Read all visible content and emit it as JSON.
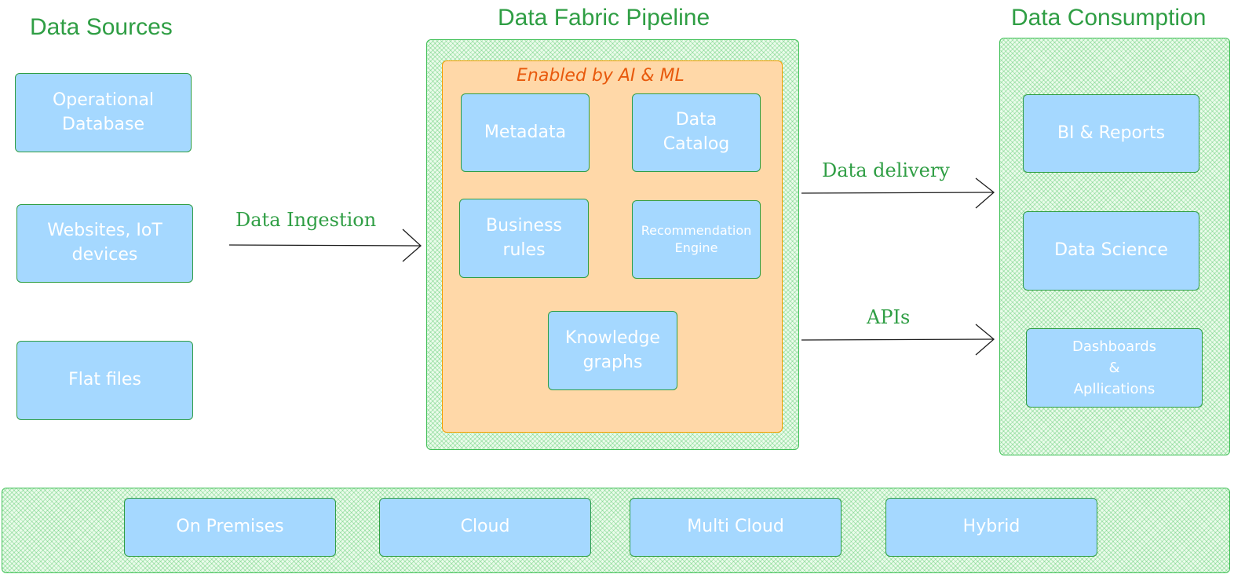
{
  "sections": {
    "sources_title": "Data Sources",
    "pipeline_title": "Data Fabric Pipeline",
    "consumption_title": "Data Consumption"
  },
  "sources": [
    {
      "label": "Operational\nDatabase"
    },
    {
      "label": "Websites, IoT\ndevices"
    },
    {
      "label": "Flat files"
    }
  ],
  "pipeline": {
    "ai_label": "Enabled by AI & ML",
    "components": [
      {
        "label": "Metadata"
      },
      {
        "label": "Data\nCatalog"
      },
      {
        "label": "Business\nrules"
      },
      {
        "label": "Recommendation\nEngine"
      },
      {
        "label": "Knowledge\ngraphs"
      }
    ]
  },
  "consumption": [
    {
      "label": "BI & Reports"
    },
    {
      "label": "Data Science"
    },
    {
      "label": "Dashboards\n&\nApllications"
    }
  ],
  "arrows": {
    "ingestion": "Data Ingestion",
    "delivery": "Data delivery",
    "apis": "APIs"
  },
  "deployment": [
    {
      "label": "On Premises"
    },
    {
      "label": "Cloud"
    },
    {
      "label": "Multi Cloud"
    },
    {
      "label": "Hybrid"
    }
  ],
  "colors": {
    "title_green": "#2f9e44",
    "box_blue": "#a5d8ff",
    "ai_orange": "#ffd8a8",
    "ai_label_orange": "#e8590c"
  }
}
